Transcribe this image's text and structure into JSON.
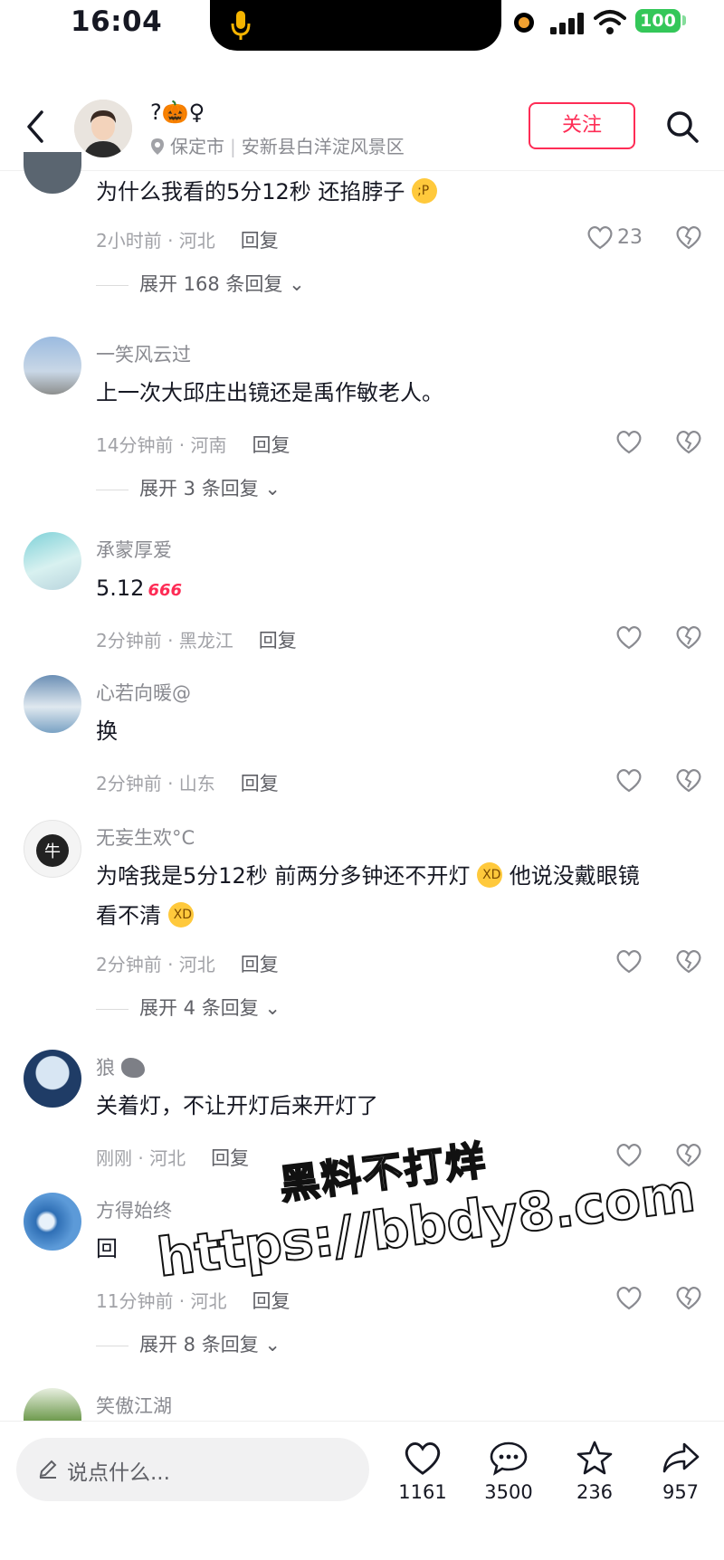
{
  "status_bar": {
    "time": "16:04",
    "battery": "100"
  },
  "header": {
    "user_name": "?🎃♀",
    "location_city": "保定市",
    "location_detail": "安新县白洋淀风景区",
    "follow_label": "关注"
  },
  "comments": [
    {
      "name": "",
      "text": "为什么我看的5分12秒 还掐脖子",
      "time": "2小时前 · 河北",
      "reply": "回复",
      "likes": "23",
      "expand": "展开 168 条回复"
    },
    {
      "name": "一笑风云过",
      "text": "上一次大邱庄出镜还是禹作敏老人。",
      "time": "14分钟前 · 河南",
      "reply": "回复",
      "expand": "展开 3 条回复"
    },
    {
      "name": "承蒙厚爱",
      "text": "5.12",
      "badge": "666",
      "time": "2分钟前 · 黑龙江",
      "reply": "回复"
    },
    {
      "name": "心若向暖@",
      "text": "换",
      "time": "2分钟前 · 山东",
      "reply": "回复"
    },
    {
      "name": "无妄生欢°C",
      "text_a": "为啥我是5分12秒 前两分多钟还不开灯",
      "text_b": "他说没戴眼镜",
      "text_c": "看不清",
      "time": "2分钟前 · 河北",
      "reply": "回复",
      "expand": "展开 4 条回复"
    },
    {
      "name": "狼",
      "text": "关着灯，不让开灯后来开灯了",
      "time": "刚刚 · 河北",
      "reply": "回复"
    },
    {
      "name": "方得始终",
      "text": "回",
      "time": "11分钟前 · 河北",
      "reply": "回复",
      "expand": "展开 8 条回复"
    },
    {
      "name": "笑傲江湖"
    }
  ],
  "watermark": {
    "line1": "黑料不打烊",
    "line2": "https://bbdy8.com"
  },
  "bottom_bar": {
    "input_placeholder": "说点什么...",
    "likes": "1161",
    "comments": "3500",
    "favorites": "236",
    "shares": "957"
  },
  "colors": {
    "accent": "#fe2c55",
    "text": "#161823",
    "muted": "#8a8b91",
    "battery": "#34c759"
  }
}
